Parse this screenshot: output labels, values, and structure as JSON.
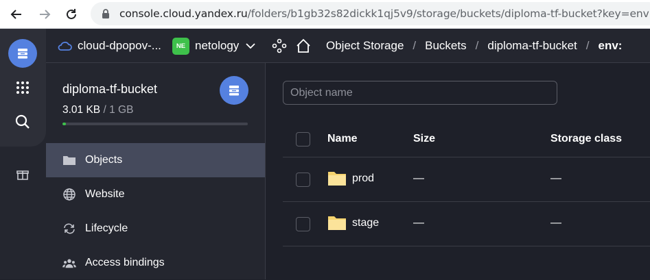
{
  "browser": {
    "url_host": "console.cloud.yandex.ru",
    "url_path": "/folders/b1gb32s82dickk1qj5v9/storage/buckets/diploma-tf-bucket?key=env"
  },
  "header": {
    "cloud": "cloud-dpopov-...",
    "org_badge": "NE",
    "org": "netology",
    "breadcrumbs": [
      "Object Storage",
      "Buckets",
      "diploma-tf-bucket",
      "env:"
    ],
    "separator": "/"
  },
  "bucket": {
    "name": "diploma-tf-bucket",
    "used": "3.01 KB",
    "limit": "/ 1 GB",
    "usage_fraction": 0.003
  },
  "nav": [
    {
      "label": "Objects",
      "icon": "folder-icon",
      "active": true
    },
    {
      "label": "Website",
      "icon": "globe-icon",
      "active": false
    },
    {
      "label": "Lifecycle",
      "icon": "refresh-icon",
      "active": false
    },
    {
      "label": "Access bindings",
      "icon": "users-icon",
      "active": false
    }
  ],
  "search": {
    "placeholder": "Object name"
  },
  "table": {
    "columns": [
      "Name",
      "Size",
      "Storage class"
    ],
    "rows": [
      {
        "name": "prod",
        "size": "—",
        "storage_class": "—"
      },
      {
        "name": "stage",
        "size": "—",
        "storage_class": "—"
      }
    ]
  },
  "colors": {
    "accent": "#5581e0",
    "badge_green": "#3ec14b",
    "active_nav": "#454a5c"
  }
}
